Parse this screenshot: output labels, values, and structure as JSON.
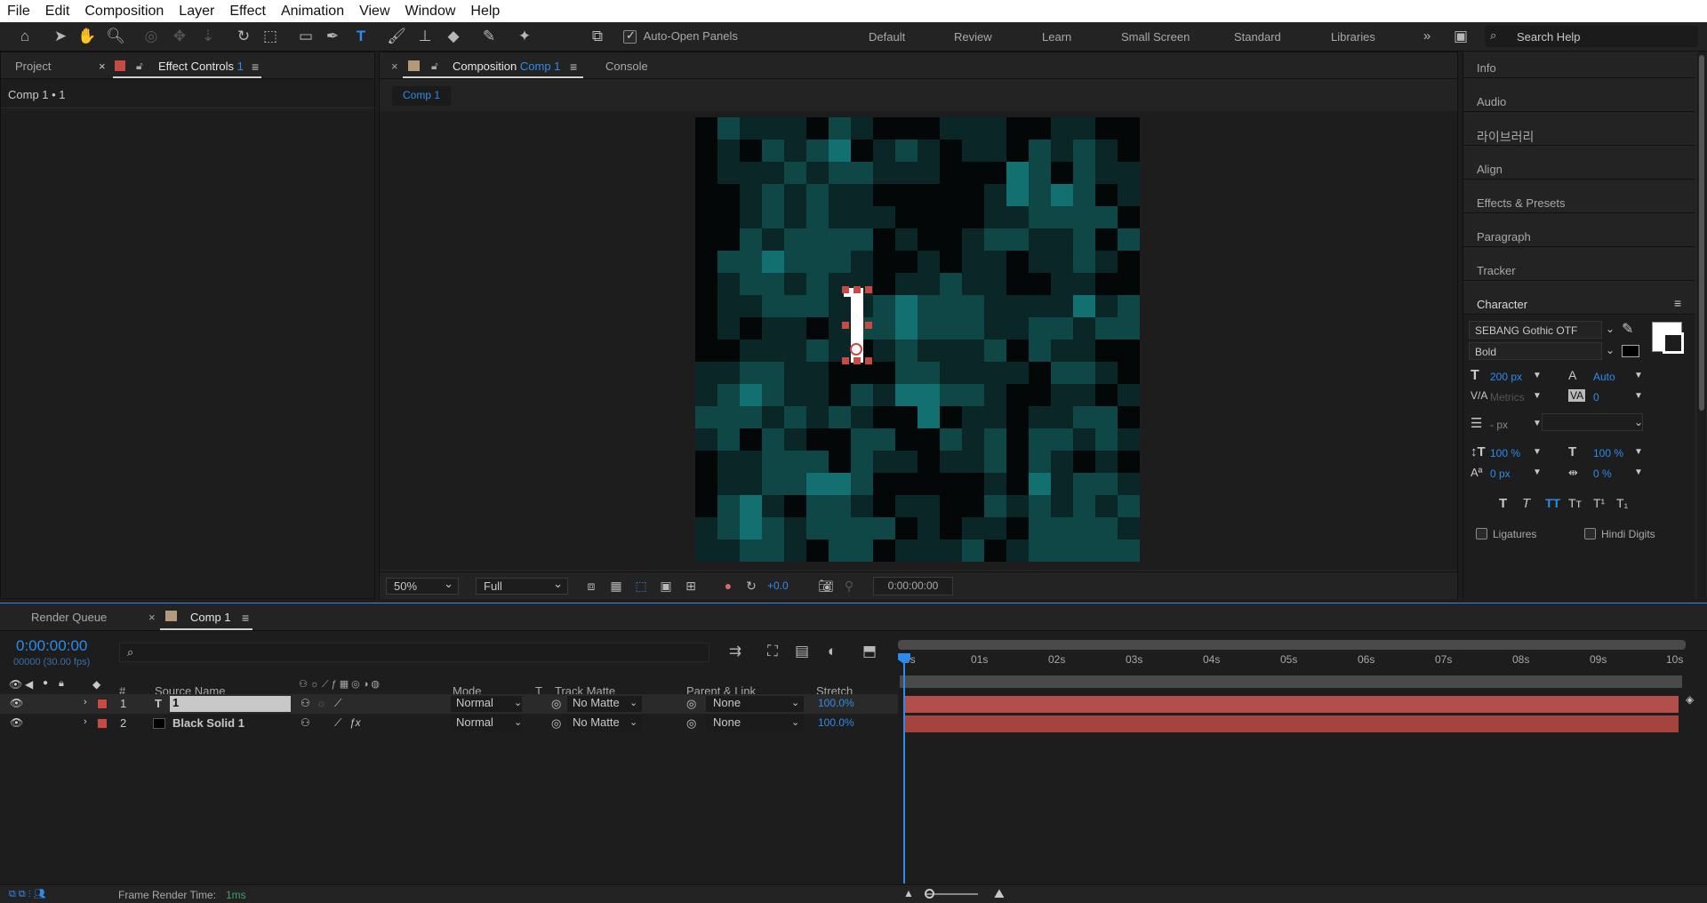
{
  "menu": [
    "File",
    "Edit",
    "Composition",
    "Layer",
    "Effect",
    "Animation",
    "View",
    "Window",
    "Help"
  ],
  "toolbar": {
    "auto_open_label": "Auto-Open Panels",
    "workspaces": [
      "Default",
      "Review",
      "Learn",
      "Small Screen",
      "Standard",
      "Libraries"
    ],
    "search_placeholder": "Search Help"
  },
  "left_panel": {
    "tab_project": "Project",
    "tab_effect_controls": "Effect Controls",
    "tab_effect_controls_num": "1",
    "header": "Comp 1 • 1"
  },
  "comp_panel": {
    "tab_label": "Composition",
    "tab_comp": "Comp 1",
    "tab_console": "Console",
    "crumb": "Comp 1",
    "text_layer_char": "1"
  },
  "viewer_bar": {
    "zoom": "50%",
    "resolution": "Full",
    "exposure": "+0.0",
    "timecode": "0:00:00:00"
  },
  "right_panel": {
    "items": [
      "Info",
      "Audio",
      "라이브러리",
      "Align",
      "Effects & Presets",
      "Paragraph",
      "Tracker"
    ],
    "character_title": "Character",
    "font": "SEBANG Gothic OTF",
    "style": "Bold",
    "font_size": "200 px",
    "leading": "Auto",
    "kerning": "Metrics",
    "tracking": "0",
    "stroke_width": "- px",
    "vscale": "100 %",
    "hscale": "100 %",
    "baseline": "0 px",
    "tsume": "0 %",
    "ligatures": "Ligatures",
    "hindi_digits": "Hindi Digits",
    "colors": {
      "fill": "#ffffff",
      "stroke": "#000000"
    }
  },
  "timeline": {
    "tab_render": "Render Queue",
    "tab_comp": "Comp 1",
    "timecode": "0:00:00:00",
    "fps_info": "00000 (30.00 fps)",
    "headers": {
      "num": "#",
      "source": "Source Name",
      "mode": "Mode",
      "t": "T",
      "track_matte": "Track Matte",
      "parent": "Parent & Link",
      "stretch": "Stretch"
    },
    "layers": [
      {
        "num": "1",
        "type": "T",
        "name": "1",
        "mode": "Normal",
        "matte": "No Matte",
        "parent": "None",
        "stretch": "100.0%"
      },
      {
        "num": "2",
        "type": "",
        "name": "Black Solid 1",
        "mode": "Normal",
        "matte": "No Matte",
        "parent": "None",
        "stretch": "100.0%"
      }
    ],
    "ruler": [
      "0s",
      "01s",
      "02s",
      "03s",
      "04s",
      "05s",
      "06s",
      "07s",
      "08s",
      "09s",
      "10s"
    ],
    "status_label": "Frame Render Time:",
    "status_value": "1ms"
  },
  "canvas_grid": [
    "02111021000111001100",
    "01021230121011021210",
    "01112122111000320211",
    "00121211000001323201",
    "00121211100001122220",
    "00212222010012211202",
    "02232221001011011210",
    "01221211011211001100",
    "01122211232221111312",
    "01011012232221122122",
    "00111210121112021100",
    "11221100022111102210",
    "12321102133221001101",
    "22212121003011011220",
    "12021002200212022121",
    "01122202110112021010",
    "01122332000001031221",
    "02310221011002121212",
    "12321222201011022221",
    "11221022011120122222"
  ]
}
